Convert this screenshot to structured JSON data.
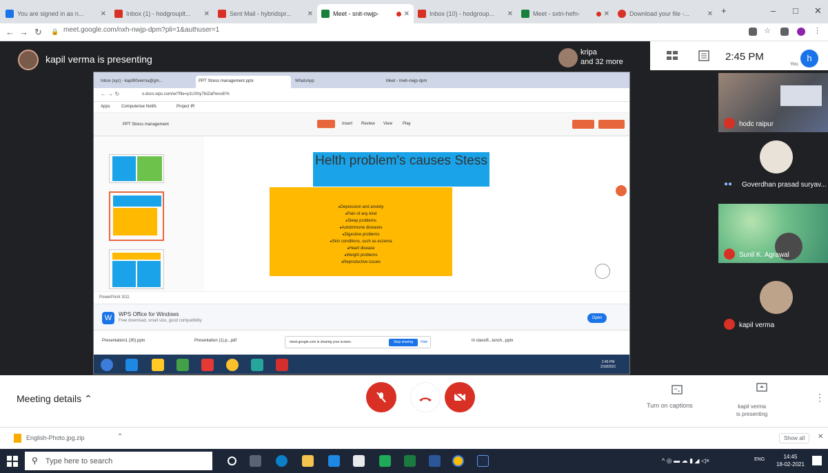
{
  "browser": {
    "tabs": [
      {
        "title": "You are signed in as n...",
        "color": "#1a73e8"
      },
      {
        "title": "Inbox (1) - hodgrouplt...",
        "color": "#d93025"
      },
      {
        "title": "Sent Mail - hybridspr...",
        "color": "#d93025"
      },
      {
        "title": "Meet - snit-nwjp-",
        "color": "#188038"
      },
      {
        "title": "Inbox (10) - hodgroup...",
        "color": "#d93025"
      },
      {
        "title": "Meet - sxtn-hefn-",
        "color": "#188038"
      },
      {
        "title": "Download your file -...",
        "color": "#d93025"
      }
    ],
    "url": "meet.google.com/nxh-nwjp-dpm?pli=1&authuser=1",
    "minimize": "–",
    "maximize": "□",
    "close": "✕",
    "new_tab": "+"
  },
  "meet": {
    "presenter": "kapil verma is presenting",
    "grid_name": "kripa",
    "grid_more": "and 32 more",
    "time": "2:45 PM",
    "you_initial": "h",
    "you_label": "You",
    "participants": [
      {
        "name": "hodc raipur"
      },
      {
        "name": "Goverdhan prasad suryav..."
      },
      {
        "name": "Sunil K. Agrawal"
      },
      {
        "name": "kapil verma"
      }
    ],
    "meeting_details": "Meeting details",
    "captions": "Turn on captions",
    "presenting": [
      "kapil verma",
      "is presenting"
    ]
  },
  "shared": {
    "tabs": [
      "Inbox (xyz) - kapil90verma@gm...",
      "PPT Stress management.pptx",
      "WhatsApp",
      "Meet - mwh-nwjp-dpm"
    ],
    "url": "o.docs.wps.com/w/?file=p1UXhy7bIZaPwvo8Yk",
    "bookmarks": [
      "Apps",
      "Computerise Notifs",
      "Project IR"
    ],
    "doc_title": "PPT Stress management",
    "menus": [
      "Insert",
      "Review",
      "View",
      "Play"
    ],
    "slide_title": "Helth problem's causes Stess",
    "bullets": [
      "Depression and anxiety",
      "Pain of any kind",
      "Sleep problems",
      "Autoimmune diseases",
      "Digestive problems",
      "Skin conditions, such as eczema",
      "Heart disease",
      "Weight problems",
      "Reproductive issues"
    ],
    "status": "PowerPoint 3/11",
    "wps_title": "WPS Office for Windows",
    "wps_sub": "Free download, small size, good compatibility",
    "wps_open": "Open",
    "downloads": [
      "Presentation1 (30).pptx",
      "Presentation (1).p...pdf",
      "In classifi...lunch...pptx"
    ],
    "sharing_text": "meet.google.com is sharing your screen.",
    "stop_sharing": "Stop sharing",
    "hide": "Hide",
    "inner_clock": [
      "2:45 PM",
      "2/18/2021"
    ]
  },
  "shelf": {
    "file": "English-Photo.jpg.zip",
    "show_all": "Show all",
    "close": "✕"
  },
  "taskbar": {
    "search_placeholder": "Type here to search",
    "time": "14:45",
    "date": "18-02-2021"
  }
}
